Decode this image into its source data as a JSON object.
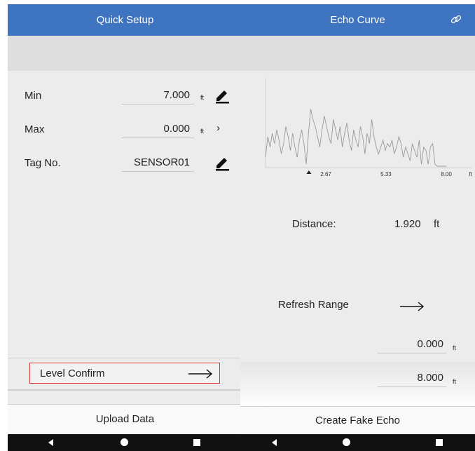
{
  "left_screen": {
    "title": "Quick Setup",
    "fields": [
      {
        "label": "Min",
        "value": "7.000",
        "unit": "ft",
        "action": "edit-icon"
      },
      {
        "label": "Max",
        "value": "0.000",
        "unit": "ft",
        "action": "chevron-right-icon"
      },
      {
        "label": "Tag No.",
        "value": "SENSOR01",
        "unit": "",
        "action": "edit-icon"
      }
    ],
    "level_confirm_label": "Level Confirm",
    "upload_label": "Upload Data"
  },
  "right_screen": {
    "title": "Echo Curve",
    "chart_data": {
      "type": "line",
      "title": "",
      "xlabel": "ft",
      "ylabel": "",
      "x_ticks": [
        "2.67",
        "5.33",
        "8.00"
      ],
      "xlim": [
        0,
        8.6
      ],
      "marker_x": 1.92,
      "series": [
        {
          "x": [
            0,
            0.1,
            0.2,
            0.3,
            0.4,
            0.5,
            0.6,
            0.7,
            0.8,
            0.9,
            1.0,
            1.1,
            1.2,
            1.3,
            1.4,
            1.5,
            1.6,
            1.7,
            1.8,
            1.9,
            2.0,
            2.1,
            2.2,
            2.3,
            2.4,
            2.5,
            2.6,
            2.7,
            2.8,
            2.9,
            3.0,
            3.1,
            3.2,
            3.3,
            3.4,
            3.5,
            3.6,
            3.7,
            3.8,
            3.9,
            4.0,
            4.1,
            4.2,
            4.3,
            4.4,
            4.5,
            4.6,
            4.7,
            4.8,
            4.9,
            5.0,
            5.1,
            5.2,
            5.3,
            5.4,
            5.5,
            5.6,
            5.7,
            5.8,
            5.9,
            6.0,
            6.1,
            6.2,
            6.3,
            6.4,
            6.5,
            6.6,
            6.7,
            6.8,
            6.9,
            7.0,
            7.1,
            7.2,
            7.3,
            7.4,
            7.5,
            7.6,
            7.7,
            7.8,
            7.9,
            8.0
          ],
          "y": [
            0.15,
            0.45,
            0.3,
            0.5,
            0.35,
            0.55,
            0.4,
            0.2,
            0.35,
            0.6,
            0.45,
            0.25,
            0.5,
            0.3,
            0.15,
            0.4,
            0.55,
            0.35,
            0.05,
            0.5,
            0.85,
            0.7,
            0.6,
            0.45,
            0.3,
            0.55,
            0.75,
            0.6,
            0.45,
            0.35,
            0.7,
            0.55,
            0.4,
            0.6,
            0.3,
            0.5,
            0.65,
            0.4,
            0.25,
            0.55,
            0.4,
            0.3,
            0.6,
            0.45,
            0.2,
            0.5,
            0.35,
            0.7,
            0.45,
            0.3,
            0.2,
            0.3,
            0.4,
            0.25,
            0.35,
            0.3,
            0.4,
            0.2,
            0.3,
            0.45,
            0.35,
            0.15,
            0.3,
            0.2,
            0.1,
            0.35,
            0.25,
            0.15,
            0.4,
            0.05,
            0.3,
            0.25,
            0.05,
            0.3,
            0.35,
            0.05,
            0.02,
            0.02,
            0.02,
            0.02,
            0.02
          ]
        }
      ]
    },
    "distance_label": "Distance:",
    "distance_value": "1.920",
    "distance_unit": "ft",
    "refresh_label": "Refresh Range",
    "range_min": "0.000",
    "range_max": "8.000",
    "range_unit": "ft",
    "fake_echo_label": "Create Fake Echo"
  }
}
